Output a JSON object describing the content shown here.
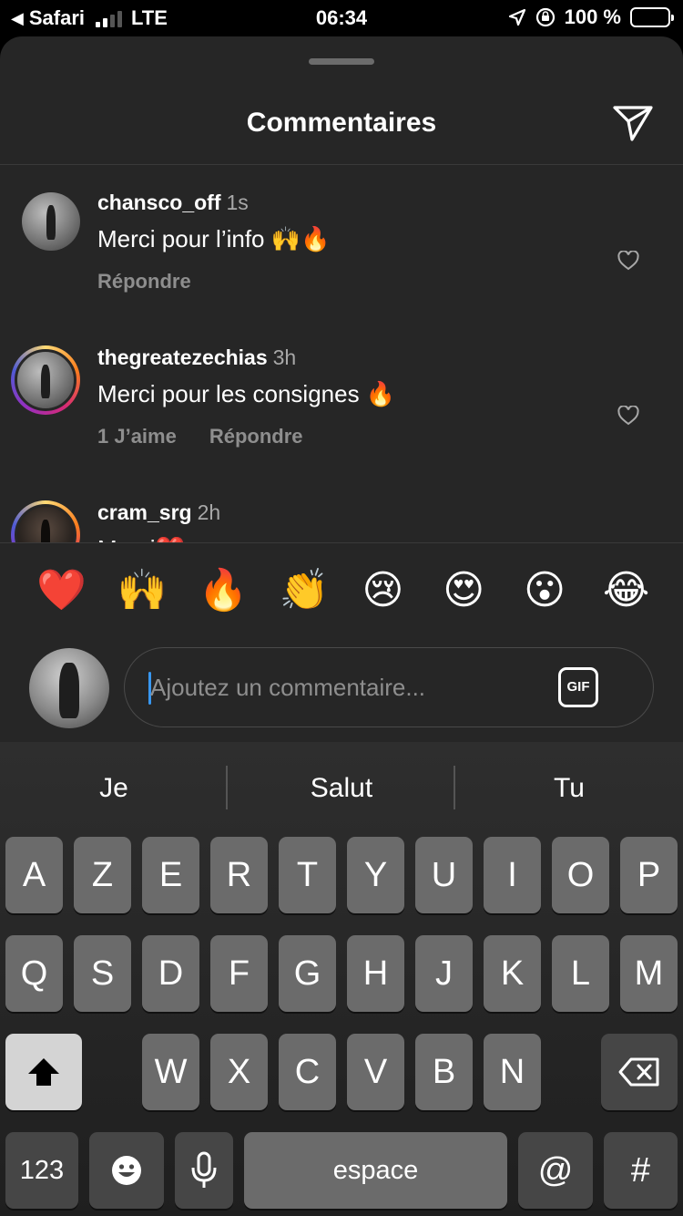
{
  "status_bar": {
    "back_app": "Safari",
    "network": "LTE",
    "time": "06:34",
    "battery": "100 %"
  },
  "sheet": {
    "title": "Commentaires",
    "comments": [
      {
        "username": "chansco_off",
        "time": "1s",
        "text": "Merci pour l’info 🙌🔥",
        "reply": "Répondre",
        "likes": ""
      },
      {
        "username": "thegreatezechias",
        "time": "3h",
        "text": "Merci pour les consignes 🔥",
        "likes": "1 J’aime",
        "reply": "Répondre"
      },
      {
        "username": "cram_srg",
        "time": "2h",
        "text": "Merci❤️",
        "reply": "",
        "likes": ""
      }
    ],
    "quick_emojis": [
      "❤️",
      "🙌",
      "🔥",
      "👏",
      "😢",
      "😍",
      "😮",
      "😂"
    ],
    "input": {
      "placeholder": "Ajoutez un commentaire...",
      "gif_label": "GIF"
    }
  },
  "keyboard": {
    "suggestions": [
      "Je",
      "Salut",
      "Tu"
    ],
    "row1": [
      "A",
      "Z",
      "E",
      "R",
      "T",
      "Y",
      "U",
      "I",
      "O",
      "P"
    ],
    "row2": [
      "Q",
      "S",
      "D",
      "F",
      "G",
      "H",
      "J",
      "K",
      "L",
      "M"
    ],
    "row3": [
      "W",
      "X",
      "C",
      "V",
      "B",
      "N"
    ],
    "numbers_label": "123",
    "space_label": "espace",
    "at_label": "@",
    "hash_label": "#"
  },
  "colors": {
    "sheet_bg": "#262626",
    "accent_blue": "#3897f0",
    "heart_red": "#ed4956",
    "muted_text": "#8e8e8e"
  }
}
